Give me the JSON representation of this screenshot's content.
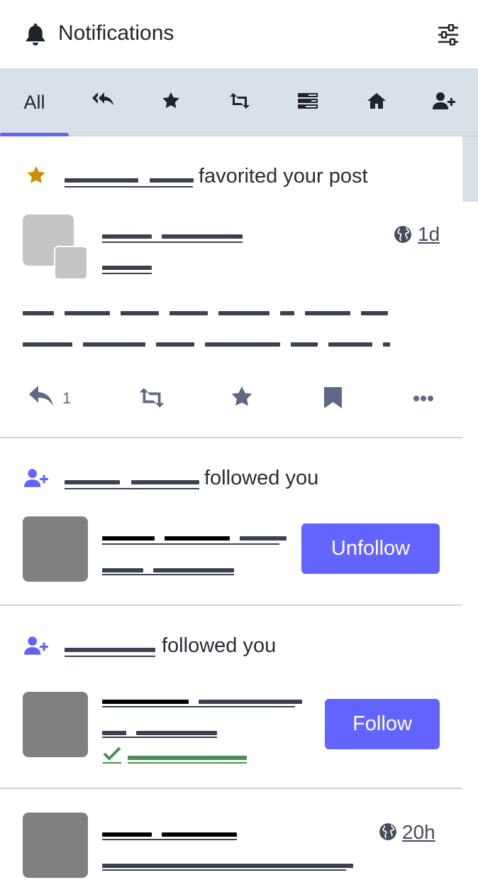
{
  "header": {
    "title": "Notifications",
    "bell_icon": "bell-icon",
    "settings_icon": "sliders-icon"
  },
  "tabs": [
    {
      "label": "All",
      "active": true
    },
    {
      "icon": "mention-reply-icon"
    },
    {
      "icon": "star-icon"
    },
    {
      "icon": "boost-icon"
    },
    {
      "icon": "poll-icon"
    },
    {
      "icon": "home-icon"
    },
    {
      "icon": "user-plus-icon"
    }
  ],
  "notifications": [
    {
      "type": "favourite",
      "action_text": "favorited your post",
      "status": {
        "time": "1d",
        "visibility_icon": "globe-icon",
        "reply_count": "1"
      }
    },
    {
      "type": "follow",
      "action_text": "followed you",
      "button_label": "Unfollow"
    },
    {
      "type": "follow",
      "action_text": "followed you",
      "button_label": "Follow",
      "verified_icon": "check-icon"
    },
    {
      "type": "status",
      "time": "20h",
      "visibility_icon": "globe-icon"
    }
  ],
  "colors": {
    "accent": "#6364ff",
    "star": "#ca8f04",
    "tabs_bg": "#d9e1e8",
    "verified": "#4a8f55"
  }
}
